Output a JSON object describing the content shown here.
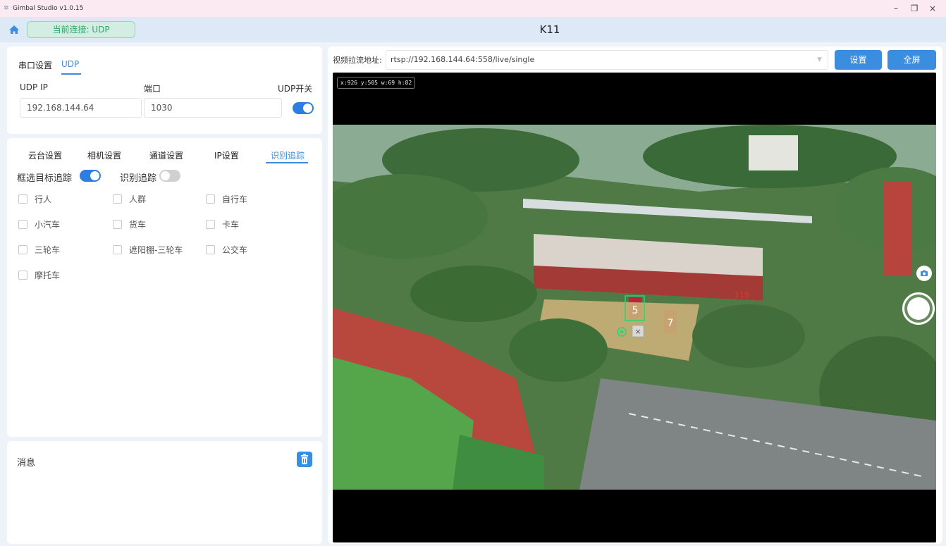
{
  "window": {
    "title": "Gimbal Studio v1.0.15",
    "controls": [
      "–",
      "❐",
      "×"
    ]
  },
  "header": {
    "connection": "当前连接: UDP",
    "device": "K11"
  },
  "connection_panel": {
    "tabs": [
      {
        "label": "串口设置",
        "active": false
      },
      {
        "label": "UDP",
        "active": true
      }
    ],
    "ip_label": "UDP IP",
    "port_label": "端口",
    "switch_label": "UDP开关",
    "ip_value": "192.168.144.64",
    "port_value": "1030",
    "udp_enabled": true
  },
  "settings_panel": {
    "tabs": [
      {
        "label": "云台设置",
        "active": false
      },
      {
        "label": "相机设置",
        "active": false
      },
      {
        "label": "通道设置",
        "active": false
      },
      {
        "label": "IP设置",
        "active": false
      },
      {
        "label": "识别追踪",
        "active": true
      }
    ],
    "box_tracking_label": "框选目标追踪",
    "box_tracking_on": true,
    "recognition_tracking_label": "识别追踪",
    "recognition_tracking_on": false,
    "targets": [
      {
        "label": "行人",
        "checked": false
      },
      {
        "label": "人群",
        "checked": false
      },
      {
        "label": "自行车",
        "checked": false
      },
      {
        "label": "小汽车",
        "checked": false
      },
      {
        "label": "货车",
        "checked": false
      },
      {
        "label": "卡车",
        "checked": false
      },
      {
        "label": "三轮车",
        "checked": false
      },
      {
        "label": "遮阳棚-三轮车",
        "checked": false
      },
      {
        "label": "公交车",
        "checked": false
      },
      {
        "label": "摩托车",
        "checked": false
      }
    ]
  },
  "message_panel": {
    "title": "消息"
  },
  "video_panel": {
    "url_label": "视频拉流地址:",
    "url": "rtsp://192.168.144.64:558/live/single",
    "settings_button": "设置",
    "fullscreen_button": "全屏",
    "overlay_coords": "x:926 y:505 w:69 h:82",
    "building_signs": [
      "5",
      "7",
      "119"
    ]
  },
  "colors": {
    "accent": "#3b8de0",
    "connected": "#30a46b",
    "header_bg": "#dde9f6",
    "title_bg": "#fbeaf1"
  }
}
